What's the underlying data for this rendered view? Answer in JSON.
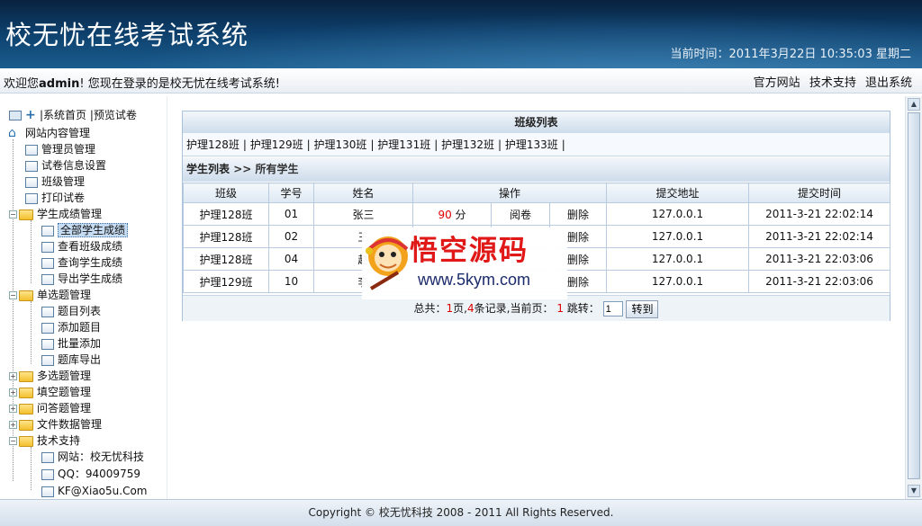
{
  "header": {
    "title": "校无忧在线考试系统",
    "datetime": "当前时间：2011年3月22日 10:35:03 星期二"
  },
  "welcome": {
    "prefix": "欢迎您",
    "user": "admin",
    "suffix": "! 您现在登录的是校无忧在线考试系统!",
    "links": [
      "官方网站",
      "技术支持",
      "退出系统"
    ]
  },
  "sidebar": {
    "top_links": [
      "系统首页",
      "预览试卷"
    ],
    "root": "网站内容管理",
    "items": [
      "管理员管理",
      "试卷信息设置",
      "班级管理",
      "打印试卷"
    ],
    "score_group": "学生成绩管理",
    "score_items": [
      "全部学生成绩",
      "查看班级成绩",
      "查询学生成绩",
      "导出学生成绩"
    ],
    "single_group": "单选题管理",
    "single_items": [
      "题目列表",
      "添加题目",
      "批量添加",
      "题库导出"
    ],
    "other_groups": [
      "多选题管理",
      "填空题管理",
      "问答题管理",
      "文件数据管理"
    ],
    "support_group": "技术支持",
    "support_items": [
      "网站：校无忧科技",
      "QQ：94009759",
      "KF@Xiao5u.Com"
    ]
  },
  "panel": {
    "class_header": "班级列表",
    "classes": [
      "护理128班",
      "护理129班",
      "护理130班",
      "护理131班",
      "护理132班",
      "护理133班"
    ],
    "student_title": "学生列表",
    "student_sub": ">> 所有学生",
    "columns": [
      "班级",
      "学号",
      "姓名",
      "操作",
      "提交地址",
      "提交时间"
    ],
    "rows": [
      {
        "class": "护理128班",
        "id": "01",
        "name": "张三",
        "score": "90",
        "unit": "分",
        "review": "阅卷",
        "delete": "删除",
        "ip": "127.0.0.1",
        "time": "2011-3-21 22:02:14"
      },
      {
        "class": "护理128班",
        "id": "02",
        "name": "王",
        "score": "",
        "unit": "",
        "review": "",
        "delete": "删除",
        "ip": "127.0.0.1",
        "time": "2011-3-21 22:02:14"
      },
      {
        "class": "护理128班",
        "id": "04",
        "name": "赵",
        "score": "",
        "unit": "",
        "review": "",
        "delete": "删除",
        "ip": "127.0.0.1",
        "time": "2011-3-21 22:03:06"
      },
      {
        "class": "护理129班",
        "id": "10",
        "name": "李",
        "score": "",
        "unit": "",
        "review": "",
        "delete": "删除",
        "ip": "127.0.0.1",
        "time": "2011-3-21 22:03:06"
      }
    ],
    "pager": {
      "total_label": "总共：",
      "pages": "1",
      "pages_unit": "页,",
      "records": "4",
      "records_unit": "条记录,",
      "current_label": "当前页：",
      "current": "1",
      "jump_label": "跳转：",
      "jump_value": "1",
      "go_label": "转到"
    }
  },
  "watermark": {
    "cn": "悟空源码",
    "url": "www.5kym.com"
  },
  "footer": "Copyright © 校无忧科技  2008 - 2011 All Rights Reserved.",
  "colors": {
    "header_dark": "#08223e",
    "header_light": "#1a5c8e",
    "accent_red": "#dd0000",
    "grid_blue": "#b8cbe0"
  }
}
